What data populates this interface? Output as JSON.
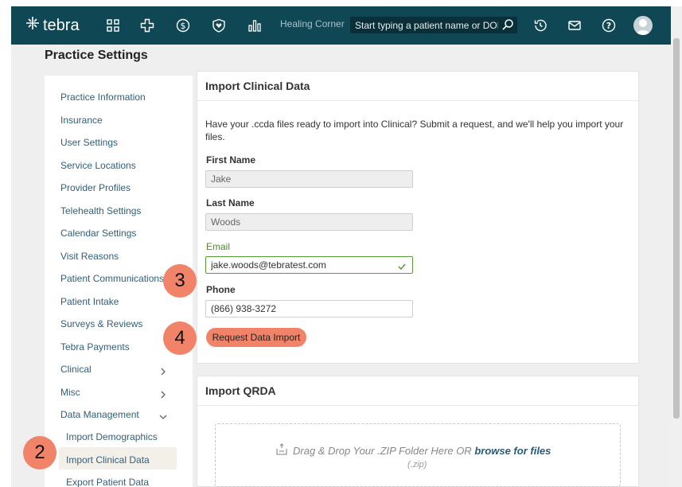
{
  "header": {
    "logo_text": "tebra",
    "nav_icons": [
      "grid-icon",
      "plus-cross-icon",
      "dollar-icon",
      "heart-shield-icon",
      "bar-chart-icon"
    ],
    "practice_name": "Healing Corner",
    "search_placeholder": "Start typing a patient name or DOB",
    "right_icons": [
      "history-icon",
      "mail-icon",
      "help-icon",
      "avatar"
    ]
  },
  "page": {
    "title": "Practice Settings"
  },
  "sidebar": {
    "items": [
      {
        "label": "Practice Information"
      },
      {
        "label": "Insurance"
      },
      {
        "label": "User Settings"
      },
      {
        "label": "Service Locations"
      },
      {
        "label": "Provider Profiles"
      },
      {
        "label": "Telehealth Settings"
      },
      {
        "label": "Calendar Settings"
      },
      {
        "label": "Visit Reasons"
      },
      {
        "label": "Patient Communications"
      },
      {
        "label": "Patient Intake"
      },
      {
        "label": "Surveys & Reviews"
      },
      {
        "label": "Tebra Payments"
      },
      {
        "label": "Clinical"
      },
      {
        "label": "Misc"
      },
      {
        "label": "Data Management"
      }
    ],
    "sub_items": [
      {
        "label": "Import Demographics"
      },
      {
        "label": "Import Clinical Data",
        "selected": true
      },
      {
        "label": "Export Patient Data"
      }
    ]
  },
  "import_clinical": {
    "title": "Import Clinical Data",
    "description": "Have your .ccda files ready to import into Clinical? Submit a request, and we'll help you import your files.",
    "first_name_label": "First Name",
    "first_name_value": "Jake",
    "last_name_label": "Last Name",
    "last_name_value": "Woods",
    "email_label": "Email",
    "email_value": "jake.woods@tebratest.com",
    "phone_label": "Phone",
    "phone_value": "(866) 938-3272",
    "button_label": "Request Data Import"
  },
  "import_qrda": {
    "title": "Import QRDA",
    "dropzone_text": "Drag & Drop Your .ZIP Folder Here OR ",
    "dropzone_link": "browse for files",
    "dropzone_sub": "(.zip)"
  },
  "step_badges": [
    "2",
    "3",
    "4"
  ],
  "colors": {
    "topbar": "#0f4754",
    "accent": "#f08368",
    "valid": "#5a9e3a",
    "link": "#2f5f7a"
  }
}
